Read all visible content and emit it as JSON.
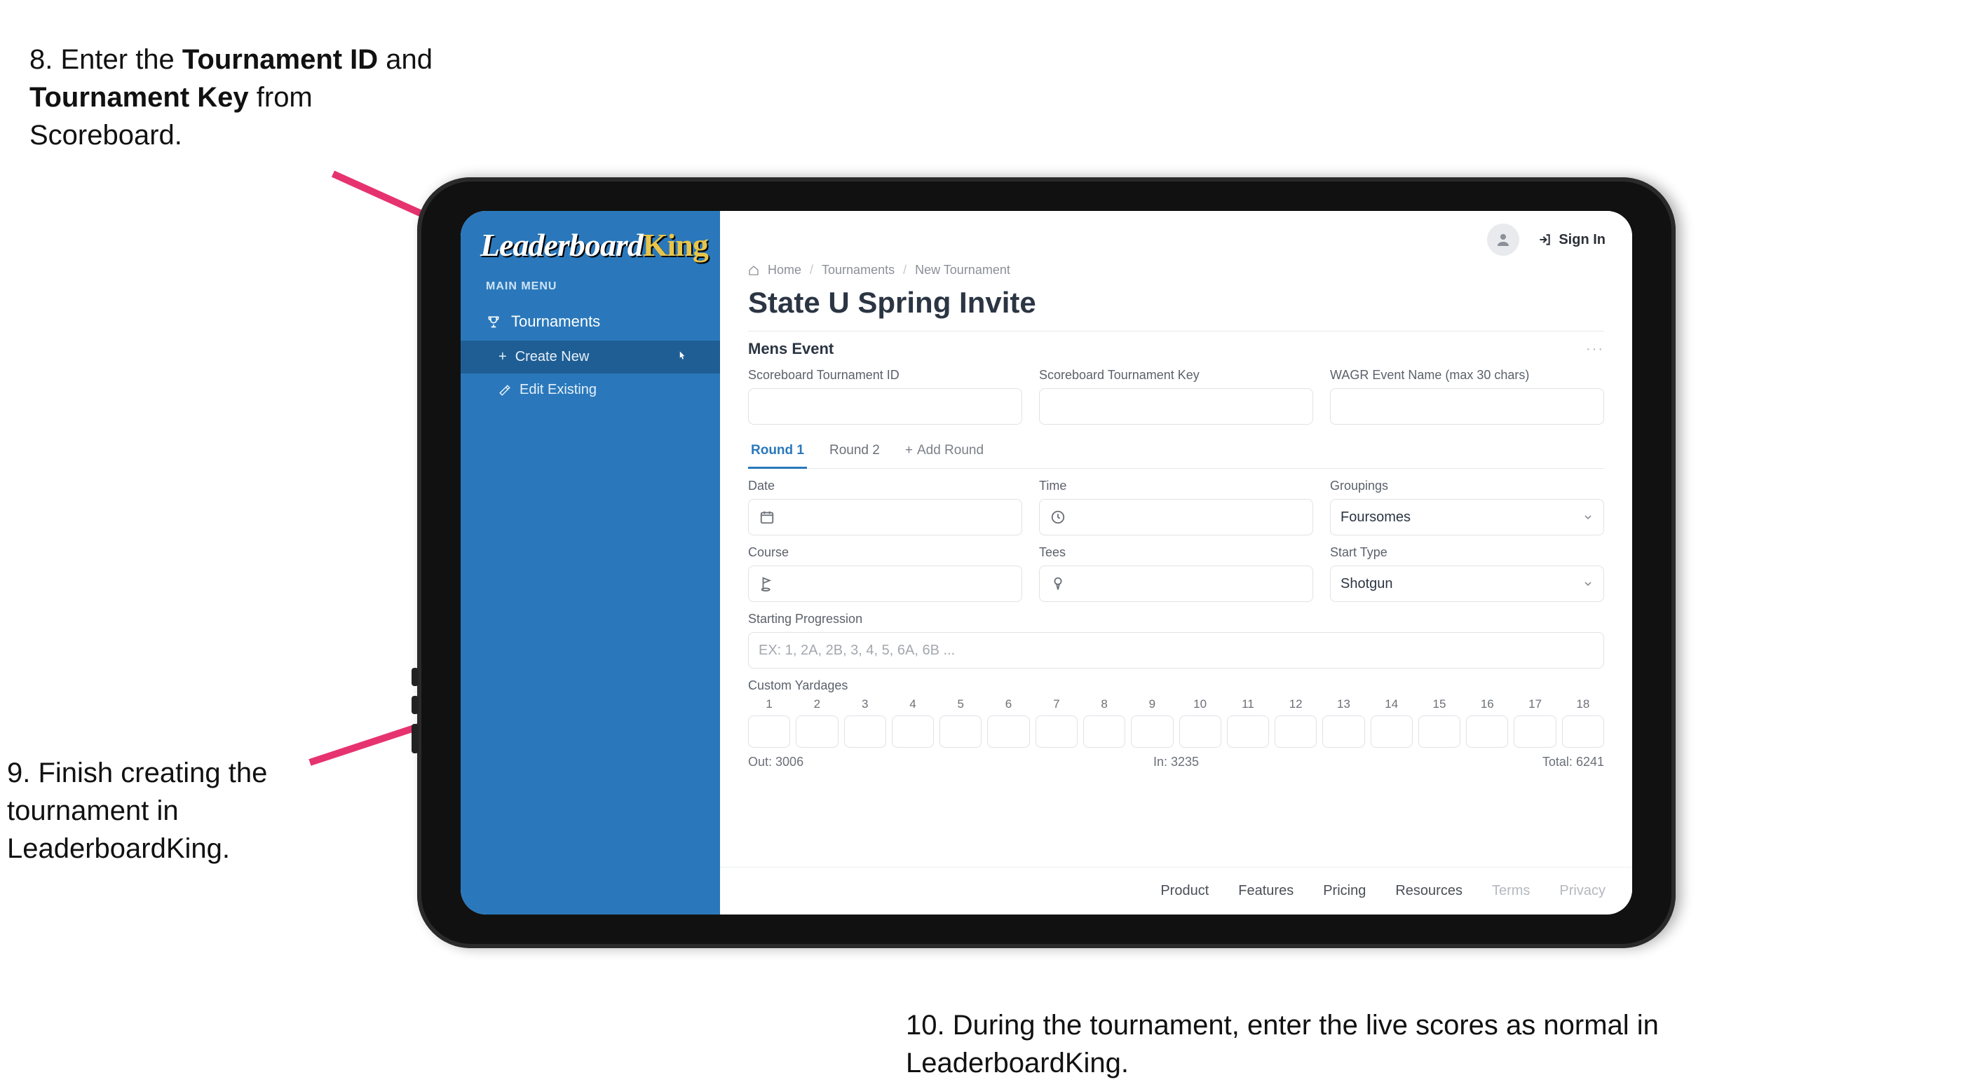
{
  "instructions": {
    "step8_prefix": "8. Enter the ",
    "step8_b1": "Tournament ID",
    "step8_mid": " and ",
    "step8_b2": "Tournament Key",
    "step8_suffix": " from Scoreboard.",
    "step9": "9. Finish creating the tournament in LeaderboardKing.",
    "step10": "10. During the tournament, enter the live scores as normal in LeaderboardKing."
  },
  "sidebar": {
    "logo_part1": "Leaderboard",
    "logo_part2": "King",
    "menu_label": "MAIN MENU",
    "tournaments": "Tournaments",
    "create_new": "Create New",
    "edit_existing": "Edit Existing"
  },
  "topbar": {
    "sign_in": "Sign In"
  },
  "breadcrumb": {
    "home": "Home",
    "tournaments": "Tournaments",
    "new_tournament": "New Tournament"
  },
  "page_title": "State U Spring Invite",
  "section": {
    "title": "Mens Event"
  },
  "labels": {
    "sb_id": "Scoreboard Tournament ID",
    "sb_key": "Scoreboard Tournament Key",
    "wagr": "WAGR Event Name (max 30 chars)",
    "date": "Date",
    "time": "Time",
    "groupings": "Groupings",
    "course": "Course",
    "tees": "Tees",
    "start_type": "Start Type",
    "start_prog": "Starting Progression",
    "start_prog_placeholder": "EX: 1, 2A, 2B, 3, 4, 5, 6A, 6B ...",
    "custom_yardages": "Custom Yardages"
  },
  "tabs": {
    "r1": "Round 1",
    "r2": "Round 2",
    "add": "Add Round"
  },
  "selects": {
    "groupings_value": "Foursomes",
    "start_type_value": "Shotgun"
  },
  "yardage": {
    "holes": [
      "1",
      "2",
      "3",
      "4",
      "5",
      "6",
      "7",
      "8",
      "9",
      "10",
      "11",
      "12",
      "13",
      "14",
      "15",
      "16",
      "17",
      "18"
    ],
    "out_label": "Out:",
    "out_value": "3006",
    "in_label": "In:",
    "in_value": "3235",
    "total_label": "Total:",
    "total_value": "6241"
  },
  "footer": {
    "product": "Product",
    "features": "Features",
    "pricing": "Pricing",
    "resources": "Resources",
    "terms": "Terms",
    "privacy": "Privacy"
  }
}
